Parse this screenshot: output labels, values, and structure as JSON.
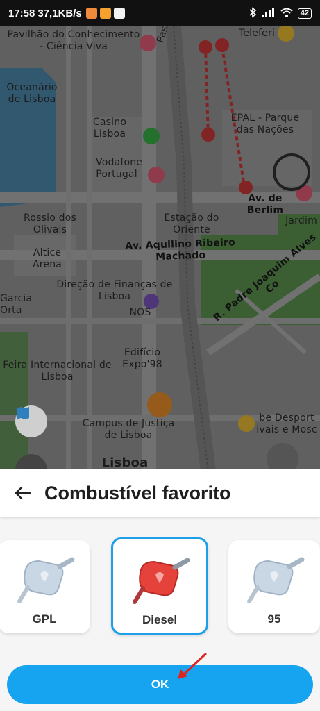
{
  "status_bar": {
    "time": "17:58",
    "net_speed": "37,1KB/s",
    "battery": "42"
  },
  "map": {
    "labels": [
      "Pavilhão do Conhecimento - Ciência Viva",
      "Oceanário de Lisboa",
      "Casino Lisboa",
      "Vodafone Portugal",
      "Rossio dos Olivais",
      "Altice Arena",
      "Direção de Finanças de Lisboa",
      "NOS",
      "Garcia Orta",
      "Feira Internacional de Lisboa",
      "Edifício Expo'98",
      "Campus de Justiça de Lisboa",
      "Lisboa",
      "Estação do Oriente",
      "Av. Aquilino Ribeiro Machado",
      "Av. de Berlim",
      "EPAL - Parque das Nações",
      "Teleferi",
      "Jardim",
      "R. Padre Joaquim Alves Co",
      "Passeio do R",
      "be Desport ivais e Mosc"
    ]
  },
  "sheet": {
    "title": "Combustível favorito",
    "fuels": [
      {
        "label": "GPL",
        "selected": false,
        "color": "#c9d6e3"
      },
      {
        "label": "Diesel",
        "selected": true,
        "color": "#e5423b"
      },
      {
        "label": "95",
        "selected": false,
        "color": "#c9d6e3"
      }
    ],
    "ok_label": "OK"
  },
  "colors": {
    "accent": "#1ea0e8",
    "ok_button": "#16a3f0",
    "arrow": "#e0231c"
  }
}
